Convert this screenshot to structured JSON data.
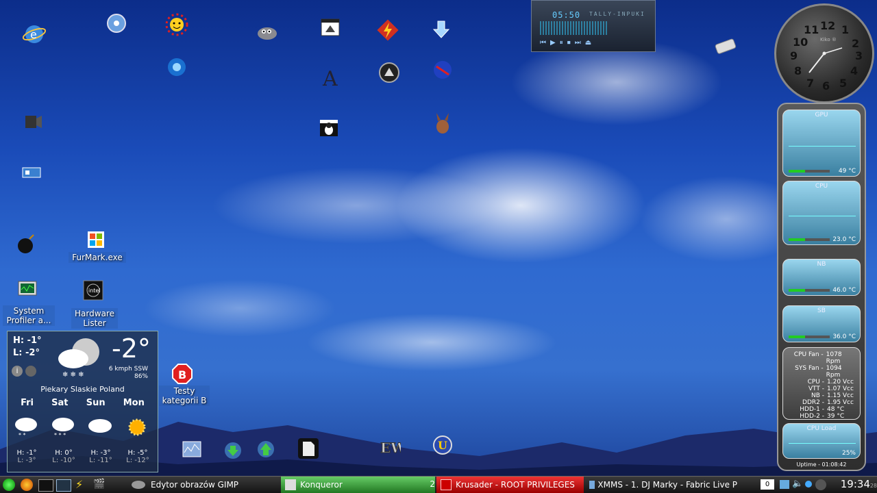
{
  "desktop": {
    "furmark_label": "FurMark.exe",
    "system_profiler_label": "System Profiler a...",
    "hardware_lister_label": "Hardware Lister",
    "testy_label": "Testy kategorii B"
  },
  "xmms_player": {
    "time": "05:50",
    "title": "TALLY-INPUKI"
  },
  "clock": {
    "brand": "Kiko ®",
    "numbers": [
      "12",
      "1",
      "2",
      "3",
      "4",
      "5",
      "6",
      "7",
      "8",
      "9",
      "10",
      "11"
    ]
  },
  "sensors": {
    "gpu": {
      "label": "GPU",
      "value": "49 °C"
    },
    "cpu": {
      "label": "CPU",
      "value": "23.0 °C"
    },
    "nb": {
      "label": "NB",
      "value": "46.0 °C"
    },
    "sb": {
      "label": "SB",
      "value": "36.0 °C"
    },
    "stats": [
      {
        "name": "CPU Fan -",
        "value": "1078 Rpm"
      },
      {
        "name": "SYS Fan -",
        "value": "1094 Rpm"
      },
      {
        "name": "CPU -",
        "value": "1.20 Vcc"
      },
      {
        "name": "VTT -",
        "value": "1.07 Vcc"
      },
      {
        "name": "NB -",
        "value": "1.15 Vcc"
      },
      {
        "name": "DDR2 -",
        "value": "1.95 Vcc"
      },
      {
        "name": "HDD-1 -",
        "value": "48 °C"
      },
      {
        "name": "HDD-2 -",
        "value": "39 °C"
      }
    ],
    "cpu_load": {
      "label": "CPU Load",
      "value": "25%"
    },
    "uptime": "Uptime - 01:08:42"
  },
  "weather": {
    "high": "H: -1°",
    "low": "L: -2°",
    "temp": "-2°",
    "wind": "6 kmph SSW",
    "humidity": "86%",
    "location": "Piekary Slaskie Poland",
    "forecast": [
      {
        "day": "Fri",
        "high": "H: -1°",
        "low": "L: -3°"
      },
      {
        "day": "Sat",
        "high": "H: 0°",
        "low": "L: -10°"
      },
      {
        "day": "Sun",
        "high": "H: -3°",
        "low": "L: -11°"
      },
      {
        "day": "Mon",
        "high": "H: -5°",
        "low": "L: -12°"
      }
    ]
  },
  "taskbar": {
    "tasks": [
      {
        "label": "Edytor obrazów GIMP"
      },
      {
        "label": "Konqueror"
      },
      {
        "label": "Krusader - ROOT PRIVILEGES"
      },
      {
        "label": "XMMS - 1. DJ Marky - Fabric Live P"
      }
    ],
    "desk_num": "2",
    "tray_num": "0",
    "time": "19:34",
    "date_day": "28"
  }
}
